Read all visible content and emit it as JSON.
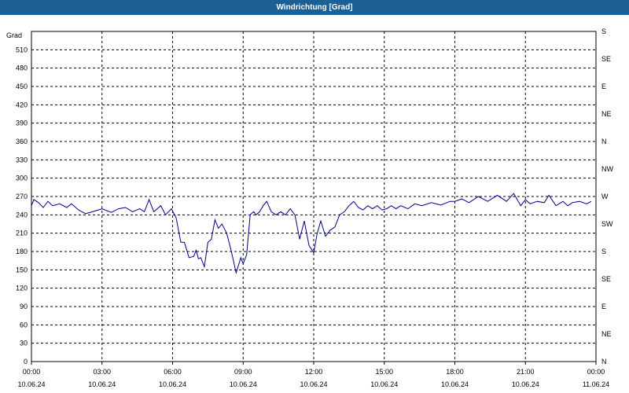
{
  "title": "Windrichtung [Grad]",
  "chart_data": {
    "type": "line",
    "title": "Windrichtung [Grad]",
    "ylabel": "Grad",
    "ylim": [
      0,
      540
    ],
    "y_ticks": [
      0,
      30,
      60,
      90,
      120,
      150,
      180,
      210,
      240,
      270,
      300,
      330,
      360,
      390,
      420,
      450,
      480,
      510
    ],
    "right_ticks": [
      "N",
      "NE",
      "E",
      "SE",
      "S",
      "SW",
      "W",
      "NW",
      "N",
      "NE",
      "E",
      "SE",
      "S"
    ],
    "x_ticks": [
      {
        "time": "00:00",
        "date": "10.06.24",
        "hour": 0
      },
      {
        "time": "03:00",
        "date": "10.06.24",
        "hour": 3
      },
      {
        "time": "06:00",
        "date": "10.06.24",
        "hour": 6
      },
      {
        "time": "09:00",
        "date": "10.06.24",
        "hour": 9
      },
      {
        "time": "12:00",
        "date": "10.06.24",
        "hour": 12
      },
      {
        "time": "15:00",
        "date": "10.06.24",
        "hour": 15
      },
      {
        "time": "18:00",
        "date": "10.06.24",
        "hour": 18
      },
      {
        "time": "21:00",
        "date": "10.06.24",
        "hour": 21
      },
      {
        "time": "00:00",
        "date": "11.06.24",
        "hour": 24
      }
    ],
    "grid": true,
    "line_color": "#00008b",
    "x": [
      0,
      0.1,
      0.3,
      0.5,
      0.7,
      0.9,
      1.2,
      1.5,
      1.7,
      2.0,
      2.3,
      2.6,
      3.0,
      3.4,
      3.7,
      4.0,
      4.3,
      4.6,
      4.8,
      5.0,
      5.2,
      5.5,
      5.7,
      5.95,
      6.15,
      6.35,
      6.5,
      6.7,
      6.9,
      7.0,
      7.1,
      7.2,
      7.35,
      7.5,
      7.65,
      7.8,
      7.95,
      8.1,
      8.3,
      8.5,
      8.7,
      8.9,
      9.0,
      9.15,
      9.3,
      9.45,
      9.55,
      9.7,
      9.85,
      10.0,
      10.2,
      10.4,
      10.6,
      10.8,
      11.0,
      11.2,
      11.4,
      11.6,
      11.8,
      12.0,
      12.15,
      12.3,
      12.5,
      12.7,
      12.9,
      13.1,
      13.3,
      13.5,
      13.7,
      13.9,
      14.1,
      14.3,
      14.5,
      14.7,
      14.9,
      15.1,
      15.3,
      15.5,
      15.7,
      16.0,
      16.3,
      16.6,
      17.0,
      17.4,
      17.8,
      18.0,
      18.3,
      18.6,
      19.0,
      19.4,
      19.8,
      20.2,
      20.5,
      20.8,
      21.0,
      21.2,
      21.5,
      21.8,
      22.0,
      22.3,
      22.6,
      22.8,
      23.0,
      23.3,
      23.6,
      23.8
    ],
    "y": [
      255,
      265,
      260,
      252,
      262,
      255,
      258,
      252,
      258,
      248,
      242,
      245,
      250,
      244,
      250,
      252,
      245,
      250,
      245,
      265,
      245,
      255,
      240,
      250,
      235,
      195,
      195,
      170,
      172,
      182,
      168,
      170,
      155,
      195,
      200,
      232,
      218,
      225,
      210,
      180,
      145,
      170,
      160,
      175,
      240,
      245,
      240,
      245,
      255,
      262,
      245,
      240,
      245,
      240,
      250,
      240,
      200,
      230,
      190,
      178,
      210,
      230,
      205,
      215,
      220,
      240,
      245,
      255,
      262,
      252,
      248,
      255,
      250,
      255,
      248,
      250,
      255,
      250,
      255,
      250,
      258,
      255,
      260,
      256,
      262,
      262,
      266,
      260,
      270,
      262,
      272,
      262,
      275,
      255,
      265,
      258,
      262,
      260,
      272,
      255,
      262,
      255,
      260,
      262,
      258,
      262
    ]
  }
}
